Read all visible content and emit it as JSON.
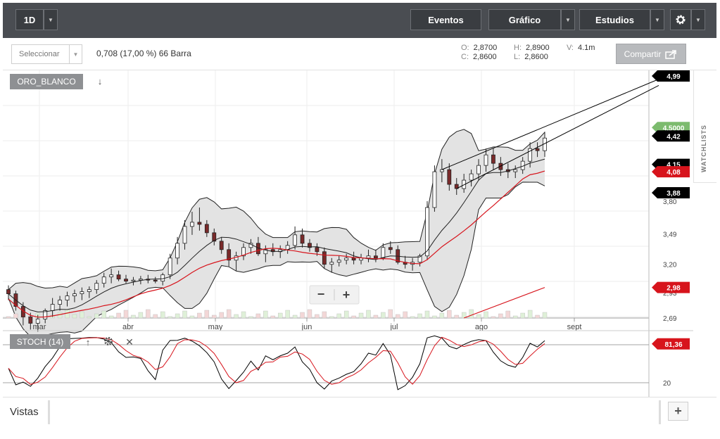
{
  "toolbar": {
    "interval": "1D",
    "events": "Eventos",
    "chart": "Gráfico",
    "studies": "Estudios",
    "caret": "▼",
    "gear_icon": "gear-icon"
  },
  "subbar": {
    "select_placeholder": "Seleccionar",
    "change_info": "0,708 (17,00 %) 66 Barra",
    "ohlc": {
      "O_label": "O:",
      "O": "2,8700",
      "H_label": "H:",
      "H": "2,8900",
      "V_label": "V:",
      "V": "4.1m",
      "C_label": "C:",
      "C": "2,8600",
      "L_label": "L:",
      "L": "2,8600"
    },
    "share": "Compartir",
    "share_icon": "share-icon"
  },
  "watchlists": "WATCHLISTS",
  "chart_data": {
    "type": "candlestick",
    "symbol": "ORO_BLANCO",
    "symbol_arrow": "↓",
    "x_axis_labels": [
      "mar",
      "abr",
      "may",
      "jun",
      "jul",
      "ago",
      "sept"
    ],
    "y_axis_labels": [
      "3,80",
      "3,49",
      "3,20",
      "2,93",
      "2,69"
    ],
    "price_markers": [
      {
        "label": "4,99",
        "color": "#000000"
      },
      {
        "label": "4,5000",
        "color": "#7cbb6e"
      },
      {
        "label": "4,42",
        "color": "#000000"
      },
      {
        "label": "4,15",
        "color": "#000000"
      },
      {
        "label": "4,08",
        "color": "#d7141c"
      },
      {
        "label": "3,88",
        "color": "#000000"
      },
      {
        "label": "2,98",
        "color": "#d7141c"
      }
    ],
    "ohlc_sample": [
      [
        2.96,
        3.0,
        2.86,
        2.92
      ],
      [
        2.92,
        2.95,
        2.76,
        2.8
      ],
      [
        2.8,
        2.84,
        2.62,
        2.7
      ],
      [
        2.7,
        2.74,
        2.58,
        2.64
      ],
      [
        2.64,
        2.72,
        2.56,
        2.68
      ],
      [
        2.68,
        2.78,
        2.64,
        2.76
      ],
      [
        2.76,
        2.88,
        2.7,
        2.82
      ],
      [
        2.82,
        2.9,
        2.76,
        2.86
      ],
      [
        2.86,
        2.94,
        2.8,
        2.9
      ],
      [
        2.9,
        2.96,
        2.84,
        2.92
      ],
      [
        2.92,
        2.98,
        2.86,
        2.94
      ],
      [
        2.94,
        2.99,
        2.88,
        2.96
      ],
      [
        2.96,
        3.05,
        2.92,
        3.02
      ],
      [
        3.02,
        3.12,
        2.98,
        3.08
      ],
      [
        3.08,
        3.16,
        3.02,
        3.1
      ],
      [
        3.1,
        3.14,
        3.04,
        3.06
      ],
      [
        3.06,
        3.1,
        3.02,
        3.04
      ],
      [
        3.04,
        3.08,
        3.0,
        3.05
      ],
      [
        3.05,
        3.09,
        3.01,
        3.06
      ],
      [
        3.06,
        3.1,
        3.02,
        3.05
      ],
      [
        3.05,
        3.08,
        3.02,
        3.04
      ],
      [
        3.04,
        3.12,
        3.0,
        3.1
      ],
      [
        3.1,
        3.3,
        3.06,
        3.26
      ],
      [
        3.26,
        3.46,
        3.2,
        3.4
      ],
      [
        3.4,
        3.62,
        3.34,
        3.56
      ],
      [
        3.56,
        3.7,
        3.48,
        3.6
      ],
      [
        3.6,
        3.74,
        3.52,
        3.58
      ],
      [
        3.58,
        3.62,
        3.46,
        3.5
      ],
      [
        3.5,
        3.54,
        3.38,
        3.42
      ],
      [
        3.42,
        3.46,
        3.3,
        3.34
      ],
      [
        3.34,
        3.4,
        3.18,
        3.24
      ],
      [
        3.24,
        3.32,
        3.14,
        3.28
      ],
      [
        3.28,
        3.4,
        3.24,
        3.36
      ],
      [
        3.36,
        3.44,
        3.3,
        3.4
      ],
      [
        3.4,
        3.46,
        3.28,
        3.3
      ],
      [
        3.3,
        3.38,
        3.22,
        3.34
      ],
      [
        3.34,
        3.4,
        3.28,
        3.32
      ],
      [
        3.32,
        3.38,
        3.26,
        3.34
      ],
      [
        3.34,
        3.42,
        3.3,
        3.38
      ],
      [
        3.38,
        3.56,
        3.34,
        3.48
      ],
      [
        3.48,
        3.54,
        3.36,
        3.4
      ],
      [
        3.4,
        3.44,
        3.32,
        3.36
      ],
      [
        3.36,
        3.4,
        3.28,
        3.32
      ],
      [
        3.32,
        3.36,
        3.16,
        3.2
      ],
      [
        3.2,
        3.26,
        3.12,
        3.22
      ],
      [
        3.22,
        3.28,
        3.18,
        3.24
      ],
      [
        3.24,
        3.3,
        3.2,
        3.26
      ],
      [
        3.26,
        3.32,
        3.2,
        3.24
      ],
      [
        3.24,
        3.3,
        3.2,
        3.26
      ],
      [
        3.26,
        3.34,
        3.22,
        3.28
      ],
      [
        3.28,
        3.34,
        3.22,
        3.26
      ],
      [
        3.26,
        3.4,
        3.24,
        3.36
      ],
      [
        3.36,
        3.42,
        3.3,
        3.34
      ],
      [
        3.34,
        3.38,
        3.2,
        3.22
      ],
      [
        3.22,
        3.28,
        3.16,
        3.2
      ],
      [
        3.2,
        3.26,
        3.14,
        3.22
      ],
      [
        3.22,
        3.3,
        3.18,
        3.28
      ],
      [
        3.28,
        3.8,
        3.24,
        3.74
      ],
      [
        3.74,
        4.14,
        3.7,
        4.08
      ],
      [
        4.08,
        4.2,
        3.98,
        4.1
      ],
      [
        4.1,
        4.16,
        3.9,
        3.96
      ],
      [
        3.96,
        4.02,
        3.86,
        3.92
      ],
      [
        3.92,
        4.06,
        3.88,
        4.0
      ],
      [
        4.0,
        4.1,
        3.94,
        4.06
      ],
      [
        4.06,
        4.2,
        4.0,
        4.14
      ],
      [
        4.14,
        4.3,
        4.08,
        4.24
      ],
      [
        4.24,
        4.3,
        4.1,
        4.16
      ],
      [
        4.16,
        4.22,
        4.04,
        4.1
      ],
      [
        4.1,
        4.16,
        4.02,
        4.08
      ],
      [
        4.08,
        4.14,
        4.02,
        4.1
      ],
      [
        4.1,
        4.22,
        4.06,
        4.18
      ],
      [
        4.18,
        4.36,
        4.12,
        4.3
      ],
      [
        4.3,
        4.36,
        4.22,
        4.28
      ],
      [
        4.28,
        4.46,
        4.22,
        4.4
      ]
    ],
    "oscillator": {
      "name": "STOCH (14)",
      "y_labels": [
        "20"
      ],
      "value_label": "81,36",
      "value_color": "#d7141c"
    }
  },
  "zoom": {
    "minus": "−",
    "plus": "+"
  },
  "footer": {
    "vistas": "Vistas",
    "add": "+"
  }
}
